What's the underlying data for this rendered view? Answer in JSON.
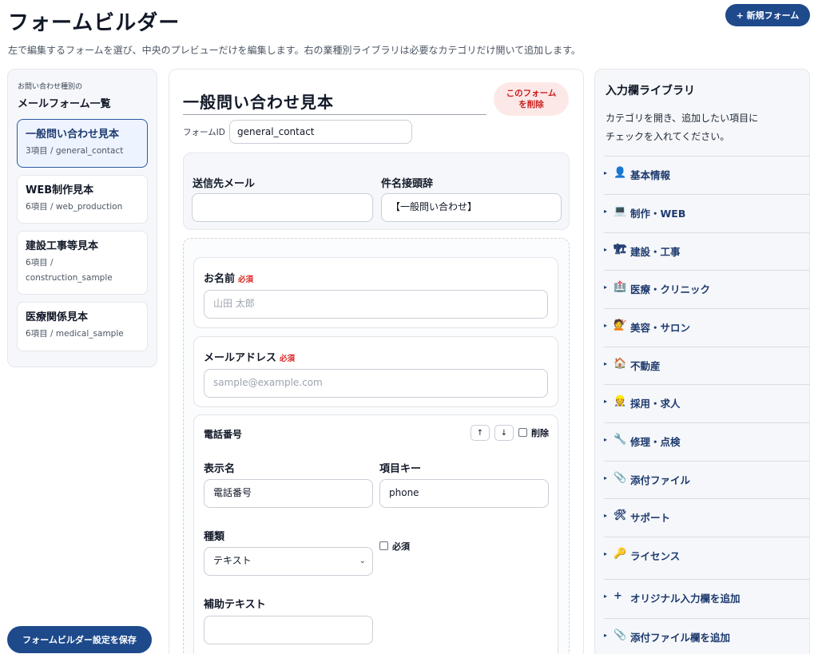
{
  "header": {
    "title": "フォームビルダー",
    "new_form_label": "+ 新規フォーム",
    "subtitle": "左で編集するフォームを選び、中央のプレビューだけを編集します。右の業種別ライブラリは必要なカテゴリだけ開いて追加します。"
  },
  "sidebar": {
    "caption": "お問い合わせ種別の",
    "title": "メールフォーム一覧",
    "forms": [
      {
        "title": "一般問い合わせ見本",
        "meta": "3項目 / general_contact"
      },
      {
        "title": "WEB制作見本",
        "meta": "6項目 / web_production"
      },
      {
        "title": "建設工事等見本",
        "meta_line1": "6項目 /",
        "meta_line2": "construction_sample"
      },
      {
        "title": "医療関係見本",
        "meta": "6項目 / medical_sample"
      }
    ],
    "save_label": "フォームビルダー設定を保存"
  },
  "editor": {
    "form_name": "一般問い合わせ見本",
    "delete_form_label_1": "このフォーム",
    "delete_form_label_2": "を削除",
    "form_id_label": "フォームID",
    "form_id_value": "general_contact",
    "mail": {
      "to_label": "送信先メール",
      "to_value": "",
      "subject_label": "件名接頭辞",
      "subject_value": "【一般問い合わせ】"
    },
    "fields": {
      "name": {
        "label": "お名前",
        "required": "必須",
        "placeholder": "山田 太郎"
      },
      "email": {
        "label": "メールアドレス",
        "required": "必須",
        "placeholder": "sample@example.com"
      },
      "phone": {
        "title": "電話番号",
        "up": "↑",
        "down": "↓",
        "delete_label": "削除",
        "display_name_label": "表示名",
        "display_name_value": "電話番号",
        "key_label": "項目キー",
        "key_value": "phone",
        "type_label": "種類",
        "type_value": "テキスト",
        "required_label": "必須",
        "help_label": "補助テキスト",
        "help_value": ""
      }
    }
  },
  "library": {
    "title": "入力欄ライブラリ",
    "desc_line1": "カテゴリを開き、追加したい項目に",
    "desc_line2": "チェックを入れてください。",
    "items": [
      {
        "icon": "👤",
        "label": "基本情報"
      },
      {
        "icon": "💻",
        "label": "制作・WEB"
      },
      {
        "icon": "🏗",
        "label": "建設・工事"
      },
      {
        "icon": "🏥",
        "label": "医療・クリニック"
      },
      {
        "icon": "💇",
        "label": "美容・サロン"
      },
      {
        "icon": "🏠",
        "label": "不動産"
      },
      {
        "icon": "👷",
        "label": "採用・求人"
      },
      {
        "icon": "🔧",
        "label": "修理・点検"
      },
      {
        "icon": "📎",
        "label": "添付ファイル"
      },
      {
        "icon": "🛠",
        "label": "サポート"
      },
      {
        "icon": "🔑",
        "label": "ライセンス"
      },
      {
        "icon": "+",
        "label": "オリジナル入力欄を追加"
      },
      {
        "icon": "📎",
        "label": "添付ファイル欄を追加"
      }
    ]
  }
}
